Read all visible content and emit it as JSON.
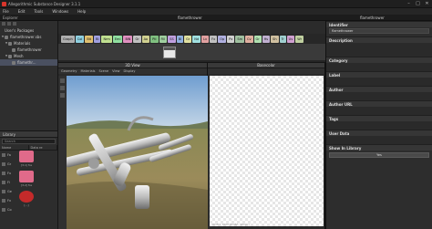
{
  "window": {
    "title": "Allegorithmic Substance Designer 3.1.1",
    "buttons": [
      "–",
      "□",
      "✕"
    ]
  },
  "menu": [
    "File",
    "Edit",
    "Tools",
    "Windows",
    "Help"
  ],
  "top_strip": {
    "left": "Explorer",
    "doc_title": "flamethrower",
    "right": "flamethrower"
  },
  "explorer": {
    "title": "Explorer",
    "tree": [
      {
        "label": "User's Packages",
        "level": 0,
        "tri": ""
      },
      {
        "label": "flamethrower.sbs",
        "level": 0,
        "tri": "▼"
      },
      {
        "label": "Materials",
        "level": 1,
        "tri": "▼"
      },
      {
        "label": "flamethrower",
        "level": 2,
        "tri": ""
      },
      {
        "label": "Mesh",
        "level": 1,
        "tri": "▼"
      },
      {
        "label": "flamethr...",
        "level": 2,
        "tri": ""
      }
    ]
  },
  "library": {
    "title": "Library",
    "search_placeholder": "Search",
    "columns": [
      "Name",
      "Data re"
    ],
    "categories": [
      "Fa",
      "Gr",
      "Fu",
      "Fi",
      "Ge",
      "Fx",
      "Co"
    ],
    "items": [
      {
        "label": "[3.1] fre",
        "color": "pink"
      },
      {
        "label": "[3.2] fre",
        "color": "pink"
      },
      {
        "label": "[...]",
        "color": "red"
      }
    ]
  },
  "graph": {
    "toolbar": [
      {
        "label": "Graph",
        "color": "#b0b0b0"
      },
      {
        "label": "Col",
        "color": "#8fd0e0"
      },
      {
        "label": "Bit",
        "color": "#e0c070"
      },
      {
        "label": "Bl",
        "color": "#a0a0e0"
      },
      {
        "label": "Nrm",
        "color": "#c0e090"
      },
      {
        "label": "Emi",
        "color": "#90e0a0"
      },
      {
        "label": "BlN",
        "color": "#e090c0"
      },
      {
        "label": "Gr",
        "color": "#c0c0c0"
      },
      {
        "label": "Ao",
        "color": "#d0d090"
      },
      {
        "label": "Ptl",
        "color": "#80c080"
      },
      {
        "label": "Fill",
        "color": "#a0d0a0"
      },
      {
        "label": "SS",
        "color": "#c0a0e0"
      },
      {
        "label": "Bl",
        "color": "#90b0e0"
      },
      {
        "label": "Gr",
        "color": "#e0e0a0"
      },
      {
        "label": "Nd",
        "color": "#a0e0e0"
      },
      {
        "label": "Lv",
        "color": "#e0a0a0"
      },
      {
        "label": "Fx",
        "color": "#c0c0c0"
      },
      {
        "label": "Op",
        "color": "#b0b0e0"
      },
      {
        "label": "Px",
        "color": "#d0d0d0"
      },
      {
        "label": "Sm",
        "color": "#a0c0a0"
      },
      {
        "label": "Cv",
        "color": "#e0b0a0"
      },
      {
        "label": "Gr",
        "color": "#b0e0b0"
      },
      {
        "label": "Hs",
        "color": "#c0b0d0"
      },
      {
        "label": "Sh",
        "color": "#d0c0a0"
      },
      {
        "label": "Tr",
        "color": "#a0d0d0"
      },
      {
        "label": "Uv",
        "color": "#d0a0d0"
      },
      {
        "label": "Wr",
        "color": "#c0d0a0"
      }
    ]
  },
  "view3d": {
    "title": "3D View",
    "menu": [
      "Geometry",
      "Materials",
      "Scene",
      "View",
      "Display"
    ]
  },
  "view2d": {
    "title": "Basecolor",
    "status": "2048 x 2048 (RGBA, 16bpc)"
  },
  "properties": {
    "header": "flamethrower",
    "sections": [
      {
        "label": "Identifier",
        "value": "flamethrower"
      },
      {
        "label": "Description",
        "value": ""
      },
      {
        "label": "Category",
        "value": ""
      },
      {
        "label": "Label",
        "value": ""
      },
      {
        "label": "Author",
        "value": ""
      },
      {
        "label": "Author URL",
        "value": ""
      },
      {
        "label": "Tags",
        "value": ""
      },
      {
        "label": "User Data",
        "value": ""
      },
      {
        "label": "Show In Library",
        "value": "Yes"
      }
    ]
  }
}
